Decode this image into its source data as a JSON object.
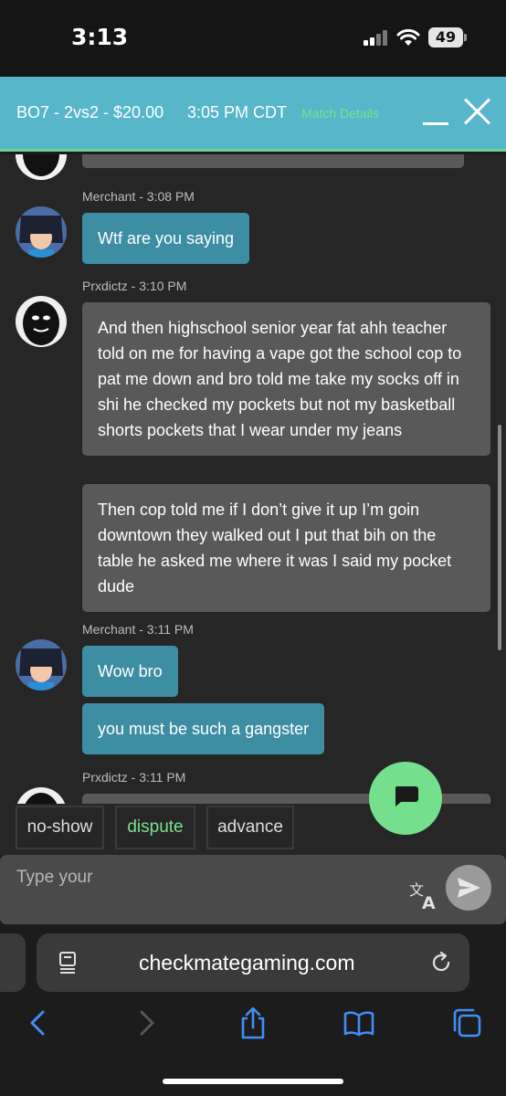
{
  "status_bar": {
    "time": "3:13",
    "battery": "49"
  },
  "match_header": {
    "title": "BO7 - 2vs2 - $20.00",
    "time": "3:05 PM CDT",
    "details_link": "Match Details"
  },
  "messages": [
    {
      "sender": "Merchant - 3:08 PM",
      "bubbles": [
        "Wtf are you saying"
      ]
    },
    {
      "sender": "Prxdictz - 3:10 PM",
      "bubbles": [
        "And then highschool senior year fat ahh teacher told on me for having a vape got the school cop to pat me down and bro told me take my socks off in shi he checked my pockets but not my basketball shorts pockets that I wear under my jeans",
        "Then cop told me if I don’t give it up I’m goin downtown they walked out I put that bih on the table he asked me where it was I said my pocket dude"
      ]
    },
    {
      "sender": "Merchant - 3:11 PM",
      "bubbles": [
        "Wow bro",
        "you must be such a gangster"
      ]
    },
    {
      "sender": "Prxdictz - 3:11 PM",
      "bubbles": []
    }
  ],
  "actions": [
    "no-show",
    "dispute",
    "advance"
  ],
  "input": {
    "placeholder": "Type your"
  },
  "browser": {
    "url": "checkmategaming.com"
  },
  "colors": {
    "header": "#57b6ca",
    "accent_green": "#74e08d",
    "teal_bubble": "#3d8ea3",
    "gray_bubble": "#595959"
  },
  "icons": [
    "translate-icon",
    "send-icon",
    "chat-icon",
    "reader-icon",
    "reload-icon",
    "back-icon",
    "forward-icon",
    "share-icon",
    "bookmarks-icon",
    "tabs-icon"
  ]
}
